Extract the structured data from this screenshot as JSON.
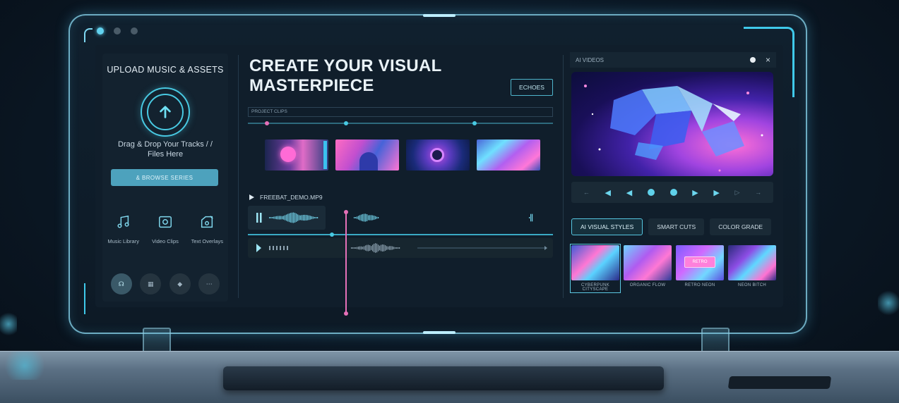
{
  "upload": {
    "title": "UPLOAD MUSIC & ASSETS",
    "drop_text": "Drag & Drop Your Tracks / / Files Here",
    "browse_label": "& BROWSE SERIES",
    "tools": [
      {
        "label": "Music Library",
        "icon": "music-note-icon"
      },
      {
        "label": "Video Clips",
        "icon": "video-clip-icon"
      },
      {
        "label": "Text Overlays",
        "icon": "text-overlay-icon"
      }
    ]
  },
  "editor": {
    "headline_line1": "CREATE YOUR VISUAL",
    "headline_line2": "MASTERPIECE",
    "echoes_label": "ECHOES",
    "timeline_label": "PROJECT CLIPS",
    "track_name": "FREEBAT_DEMO.MP9",
    "wave_badge": "sequence"
  },
  "preview": {
    "header_title": "AI VIDEOS",
    "close_glyph": "×"
  },
  "tabs": [
    {
      "label": "AI VISUAL STYLES",
      "active": true
    },
    {
      "label": "SMART CUTS",
      "active": false
    },
    {
      "label": "COLOR GRADE",
      "active": false
    }
  ],
  "styles": [
    {
      "label": "CYBERPUNK CITYSCAPE",
      "active": true
    },
    {
      "label": "ORGANIC FLOW",
      "active": false
    },
    {
      "label": "RETRO NEON",
      "active": false,
      "inset": "RETRO"
    },
    {
      "label": "NEON BITCH",
      "active": false
    }
  ],
  "colors": {
    "accent": "#48c9e2",
    "playhead": "#e570b8",
    "frame": "#8cdcf5"
  }
}
